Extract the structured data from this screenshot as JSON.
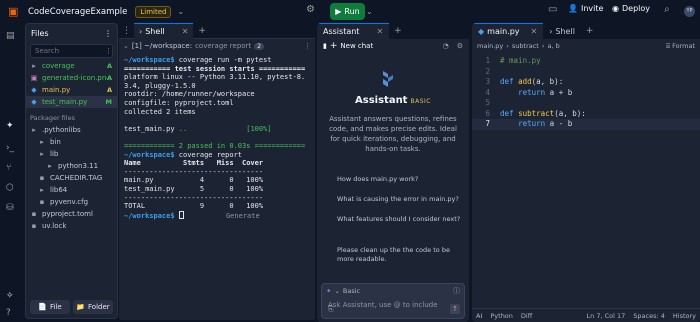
{
  "topbar": {
    "project_name": "CodeCoverageExample",
    "limited_label": "Limited",
    "run_label": "Run",
    "invite_label": "Invite",
    "deploy_label": "Deploy",
    "avatar_initials": "YP"
  },
  "files_panel": {
    "title": "Files",
    "search_placeholder": "Search",
    "files": [
      {
        "name": "coverage",
        "badge": "A",
        "color": "#46c35a",
        "icon": "folder-icon"
      },
      {
        "name": "generated-icon.png",
        "badge": "A",
        "color": "#46c35a",
        "icon": "image-icon"
      },
      {
        "name": "main.py",
        "badge": "A",
        "color": "#e5c24f",
        "icon": "python-icon"
      },
      {
        "name": "test_main.py",
        "badge": "M",
        "color": "#46c35a",
        "icon": "python-icon"
      }
    ],
    "packager_label": "Packager files",
    "packager": [
      {
        "name": ".pythonlibs",
        "indent": 0
      },
      {
        "name": "bin",
        "indent": 1
      },
      {
        "name": "lib",
        "indent": 1
      },
      {
        "name": "python3.11",
        "indent": 2
      },
      {
        "name": "CACHEDIR.TAG",
        "indent": 1
      },
      {
        "name": "lib64",
        "indent": 1
      },
      {
        "name": "pyvenv.cfg",
        "indent": 1
      },
      {
        "name": "pyproject.toml",
        "indent": 0
      },
      {
        "name": "uv.lock",
        "indent": 0
      }
    ],
    "file_button": "File",
    "folder_button": "Folder"
  },
  "shell": {
    "tab_label": "Shell",
    "path": "~/workspace:",
    "path_suffix": "coverage report",
    "badge_count": "2",
    "generate_label": "Generate",
    "lines": [
      "run_cmd",
      "session",
      "platform linux -- Python 3.11.10, pytest-8.",
      "3.4, pluggy-1.5.0",
      "rootdir: /home/runner/workspace",
      "configfile: pyproject.toml",
      "collected 2 items",
      "",
      "test_line",
      "",
      "passed_line",
      "report_cmd",
      "Name          Stmts   Miss  Cover",
      "---------------------------------",
      "main.py           4      0   100%",
      "test_main.py      5      0   100%",
      "---------------------------------",
      "TOTAL             9      0   100%",
      "final_prompt"
    ],
    "run_command": "coverage run -m pytest",
    "session_text": "=========== test session starts ===========",
    "test_file": "test_main.py",
    "test_dots": " ..",
    "test_pct": "[100%]",
    "passed_text": "============ 2 passed in 0.03s ============",
    "report_command": "coverage report",
    "prompt_label": "~/workspace$"
  },
  "assistant": {
    "tab_label": "Assistant",
    "new_chat_label": "New chat",
    "title": "Assistant",
    "tier": "BASIC",
    "description": "Assistant answers questions, refines code, and makes precise edits. Ideal for quick iterations, debugging, and hands-on tasks.",
    "suggestions": [
      "How does main.py work?",
      "What is causing the error in main.py?",
      "What features should I consider next?",
      "Please clean up the the code to be more readable."
    ],
    "mode_label": "Basic",
    "input_placeholder": "Ask Assistant, use @ to include"
  },
  "editor": {
    "tabs": [
      {
        "label": "main.py",
        "active": true
      },
      {
        "label": "Shell",
        "active": false
      }
    ],
    "breadcrumb": [
      "main.py",
      "subtract",
      "a, b"
    ],
    "format_label": "Format",
    "code": [
      {
        "n": "1",
        "tokens": [
          [
            "# main.py",
            "com"
          ]
        ]
      },
      {
        "n": "2",
        "tokens": []
      },
      {
        "n": "3",
        "tokens": [
          [
            "def ",
            "kw"
          ],
          [
            "add",
            "fn"
          ],
          [
            "(a, b):",
            "txt"
          ]
        ]
      },
      {
        "n": "4",
        "tokens": [
          [
            "    ",
            "txt"
          ],
          [
            "return",
            "kw"
          ],
          [
            " a + b",
            "txt"
          ]
        ]
      },
      {
        "n": "5",
        "tokens": []
      },
      {
        "n": "6",
        "tokens": [
          [
            "def ",
            "kw"
          ],
          [
            "subtract",
            "fn"
          ],
          [
            "(a, b):",
            "txt"
          ]
        ]
      },
      {
        "n": "7",
        "tokens": [
          [
            "    ",
            "txt"
          ],
          [
            "return",
            "kw"
          ],
          [
            " a - b",
            "txt"
          ]
        ]
      }
    ],
    "current_line": "7",
    "status": {
      "ai": "AI",
      "language": "Python",
      "diff": "Diff",
      "position": "Ln 7, Col 17",
      "spaces": "Spaces: 4",
      "history": "History"
    }
  }
}
